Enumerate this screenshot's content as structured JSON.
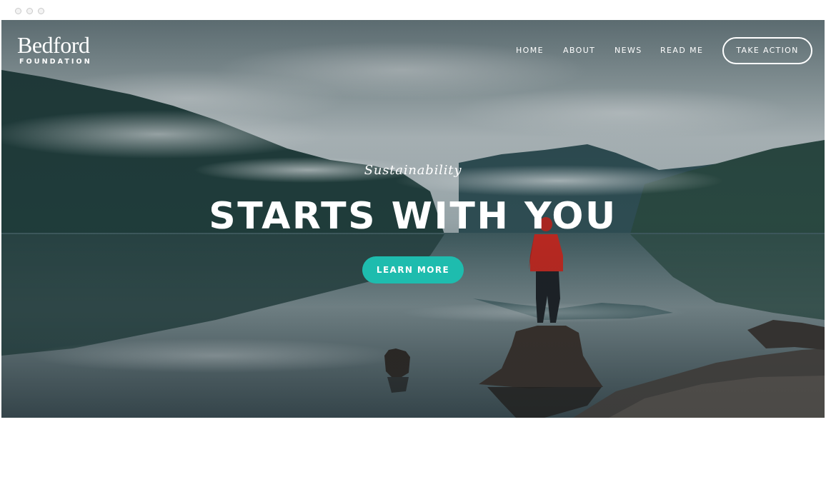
{
  "brand": {
    "name": "Bedford",
    "subtitle": "FOUNDATION"
  },
  "nav": {
    "items": [
      "HOME",
      "ABOUT",
      "NEWS",
      "READ ME"
    ],
    "cta_label": "TAKE ACTION"
  },
  "hero": {
    "kicker": "Sustainability",
    "headline": "STARTS WITH YOU",
    "button_label": "LEARN MORE",
    "background": "misty-lake-mountains-photo"
  },
  "colors": {
    "accent": "#1ebcae",
    "text": "#ffffff"
  }
}
